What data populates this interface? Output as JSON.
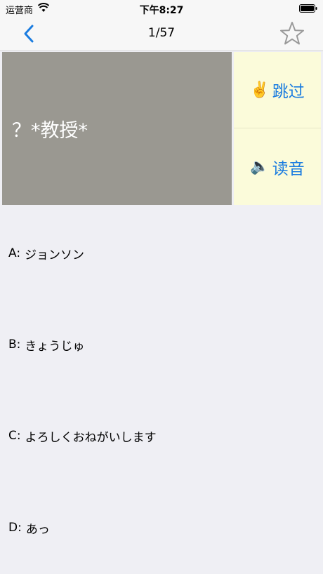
{
  "status": {
    "carrier": "运营商",
    "time": "下午8:27"
  },
  "nav": {
    "title": "1/57"
  },
  "question": {
    "text": "？*教授*"
  },
  "side": {
    "skip_emoji": "✌️",
    "skip_label": "跳过",
    "read_emoji": "🔈",
    "read_label": "读音"
  },
  "options": [
    {
      "letter": "A:",
      "text": "ジョンソン"
    },
    {
      "letter": "B:",
      "text": "きょうじゅ"
    },
    {
      "letter": "C:",
      "text": "よろしくおねがいします"
    },
    {
      "letter": "D:",
      "text": "あっ"
    }
  ],
  "colors": {
    "accent": "#1a7ce0",
    "question_bg": "#9a9891",
    "side_bg": "#fbfbda",
    "page_bg": "#efeff4"
  }
}
